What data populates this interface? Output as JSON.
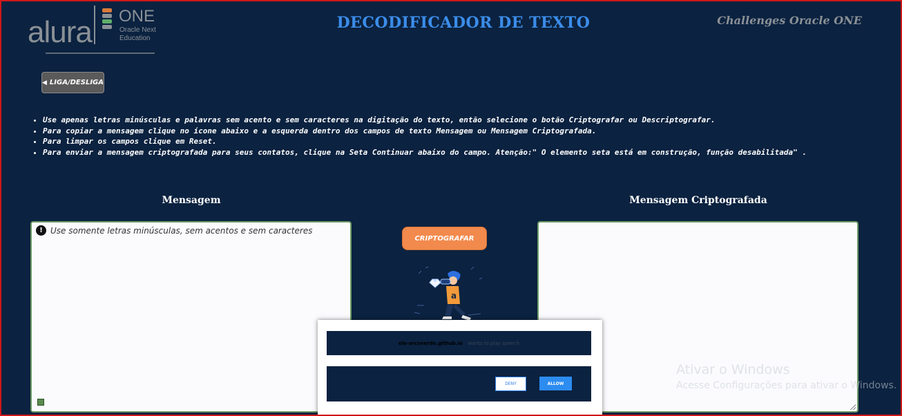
{
  "header": {
    "logo": {
      "brand": "alura",
      "program": "ONE",
      "subtitle": "Oracle Next Education"
    },
    "title": "DECODIFICADOR DE TEXTO",
    "challenges": "Challenges Oracle ONE"
  },
  "power_button": {
    "label": "LIGA/DESLIGA",
    "icon": "speaker-icon"
  },
  "instructions": [
    "Use apenas letras minúsculas e palavras sem acento e sem caracteres na digitação do texto, então selecione o botão Criptografar ou Descriptografar.",
    "Para copiar a mensagem clique no ícone abaixo e a esquerda dentro dos campos de texto Mensagem ou Mensagem Criptografada.",
    "Para limpar os campos clique em Reset.",
    "Para enviar a mensagem criptografada para seus contatos, clique na Seta Continuar abaixo do campo. Atenção:\" O elemento seta está em construção, função desabilitada\" ."
  ],
  "left_panel": {
    "label": "Mensagem",
    "placeholder": "Use somente letras minúsculas, sem acentos e sem caracteres",
    "value": ""
  },
  "right_panel": {
    "label": "Mensagem Criptografada",
    "value": ""
  },
  "encrypt_button": {
    "label": "CRIPTOGRAFAR"
  },
  "permission_dialog": {
    "site": "ele-arcoverde.github.io",
    "message": "wants to play speech",
    "deny_label": "DENY",
    "allow_label": "ALLOW"
  },
  "windows_watermark": {
    "title": "Ativar o Windows",
    "subtitle": "Acesse Configurações para ativar o Windows."
  },
  "colors": {
    "background": "#0b2240",
    "title_blue": "#3b8dea",
    "button_orange": "#f28a4d",
    "textbox_border": "#6d9b66",
    "allow_blue": "#2d8cf0"
  }
}
